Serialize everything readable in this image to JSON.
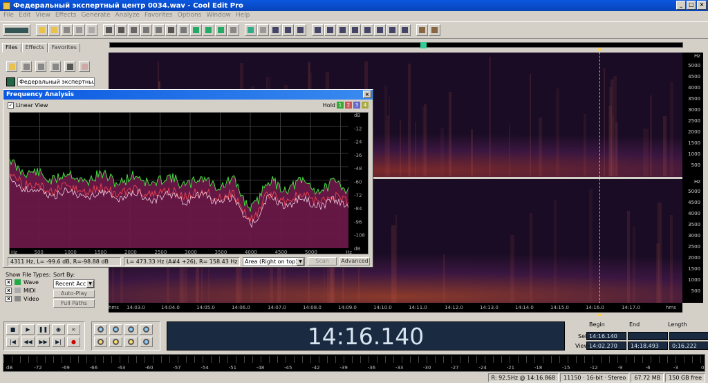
{
  "window": {
    "title": "Федеральный экспертный центр 0034.wav - Cool Edit Pro"
  },
  "menu": [
    "File",
    "Edit",
    "View",
    "Effects",
    "Generate",
    "Analyze",
    "Favorites",
    "Options",
    "Window",
    "Help"
  ],
  "panel": {
    "tabs": [
      "Files",
      "Effects",
      "Favorites"
    ],
    "file_item": "Федеральный экспертны...",
    "show_types_label": "Show File Types:",
    "types": [
      "Wave",
      "MIDI",
      "Video"
    ],
    "sort_label": "Sort By:",
    "sort_value": "Recent Acc",
    "auto_play": "Auto-Play",
    "full_paths": "Full Paths"
  },
  "freq": {
    "title": "Frequency Analysis",
    "linear_view": "Linear View",
    "hold_label": "Hold",
    "hold_buttons": [
      "1",
      "2",
      "3",
      "4"
    ],
    "db_ticks": [
      "dB",
      "-12",
      "-24",
      "-36",
      "-48",
      "-60",
      "-72",
      "-84",
      "-96",
      "-108",
      "dB"
    ],
    "hz_ticks": [
      "Hz",
      "500",
      "1000",
      "1500",
      "2000",
      "2500",
      "3000",
      "3500",
      "4000",
      "4500",
      "5000",
      "Hz"
    ],
    "status_left": "4311 Hz, L= -99.6 dB, R=-98.88 dB",
    "status_mid": "L= 473.33 Hz (A#4 +26), R= 158.43 Hz (D#3",
    "area_select": "Area (Right on top)",
    "scan_btn": "Scan",
    "advanced_btn": "Advanced"
  },
  "spectro": {
    "hz_ticks": [
      "Hz",
      "5000",
      "4500",
      "4000",
      "3500",
      "3000",
      "2500",
      "2000",
      "1500",
      "1000",
      "500"
    ],
    "hz_ticks_lower": [
      "Hz",
      "5000",
      "4500",
      "4000",
      "3500",
      "3000",
      "2500",
      "2000",
      "1500",
      "1000",
      "500"
    ],
    "time_ticks": [
      "hms",
      "14:03.0",
      "14:04.0",
      "14:05.0",
      "14:06.0",
      "14:07.0",
      "14:08.0",
      "14:09.0",
      "14:10.0",
      "14:11.0",
      "14:12.0",
      "14:13.0",
      "14:14.0",
      "14:15.0",
      "14:16.0",
      "14:17.0",
      "hms"
    ]
  },
  "time_display": "14:16.140",
  "selview": {
    "head": [
      "Begin",
      "End",
      "Length"
    ],
    "sel_label": "Sel",
    "view_label": "View",
    "sel": [
      "14:16.140",
      "",
      ""
    ],
    "view": [
      "14:02.270",
      "14:18.493",
      "0:16.222"
    ]
  },
  "meter_ticks": [
    "dB",
    "-72",
    "-69",
    "-66",
    "-63",
    "-60",
    "-57",
    "-54",
    "-51",
    "-48",
    "-45",
    "-42",
    "-39",
    "-36",
    "-33",
    "-30",
    "-27",
    "-24",
    "-21",
    "-18",
    "-15",
    "-12",
    "-9",
    "-6",
    "-3",
    "0"
  ],
  "status": {
    "pos": "R: 92.5Hz @ 14:16.868",
    "format": "11150 · 16-bit · Stereo",
    "size": "67.72 MB",
    "free": "150 GB free"
  }
}
